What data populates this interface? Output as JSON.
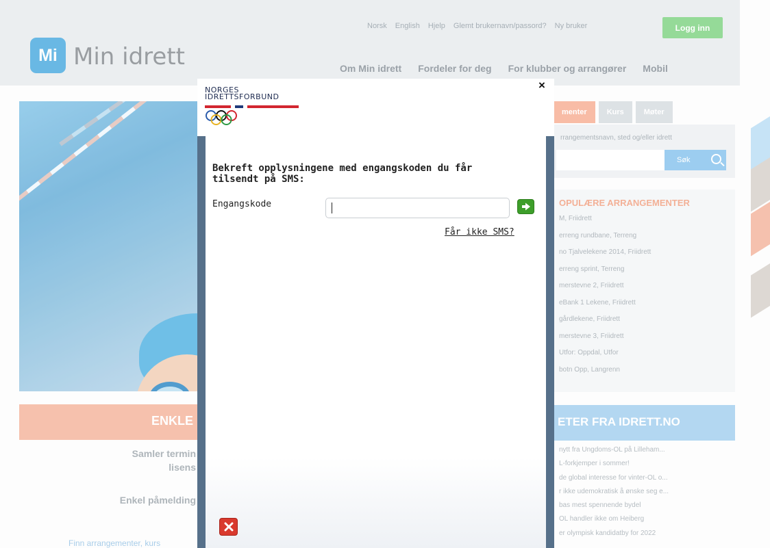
{
  "site": {
    "logo_mark": "Mi",
    "logo_text": "Min idrett",
    "top_links": [
      "Norsk",
      "English",
      "Hjelp",
      "Glemt brukernavn/passord?",
      "Ny bruker"
    ],
    "login_label": "Logg inn",
    "nav": [
      "Om Min idrett",
      "Fordeler for deg",
      "For klubber og arrangører",
      "Mobil"
    ]
  },
  "search": {
    "tabs": [
      "menter",
      "Kurs",
      "Møter"
    ],
    "hint": "rrangementsnavn, sted og/eller idrett",
    "button_label": "Søk"
  },
  "popular": {
    "title": "OPULÆRE ARRANGEMENTER",
    "items": [
      "M, Friidrett",
      "erreng rundbane, Terreng",
      "no Tjalvelekene 2014, Friidrett",
      "erreng sprint, Terreng",
      "merstevne 2, Friidrett",
      "eBank 1 Lekene, Friidrett",
      "gårdlekene, Friidrett",
      "merstevne 3, Friidrett",
      "Utfor: Oppdal, Utfor",
      "botn Opp, Langrenn"
    ]
  },
  "left": {
    "banner": "ENKLE",
    "line1": "Samler termin",
    "line2": "lisens",
    "line3": "Enkel påmelding",
    "link": "Finn arrangementer, kurs"
  },
  "news": {
    "title": "ETER FRA IDRETT.NO",
    "items": [
      "nytt fra Ungdoms-OL på Lilleham...",
      "L-forkjemper i sommer!",
      "de global interesse for vinter-OL o...",
      "r ikke udemokratisk å ønske seg e...",
      "bas mest spennende bydel",
      "OL handler ikke om Heiberg",
      "er olympisk kandidatby for 2022"
    ]
  },
  "modal": {
    "org_line1": "NORGES",
    "org_line2": "IDRETTSFORBUND",
    "close_label": "×",
    "title": "Bekreft opplysningene med engangskoden du får tilsendt på SMS:",
    "field_label": "Engangskode",
    "field_value": "",
    "no_sms_link": "Får ikke SMS?",
    "colors": {
      "submit": "#3d9e2a",
      "cancel": "#d93a2e",
      "frame": "#56708a"
    },
    "icons": {
      "submit": "arrow-right-icon",
      "cancel": "x-icon",
      "close": "close-icon"
    }
  }
}
